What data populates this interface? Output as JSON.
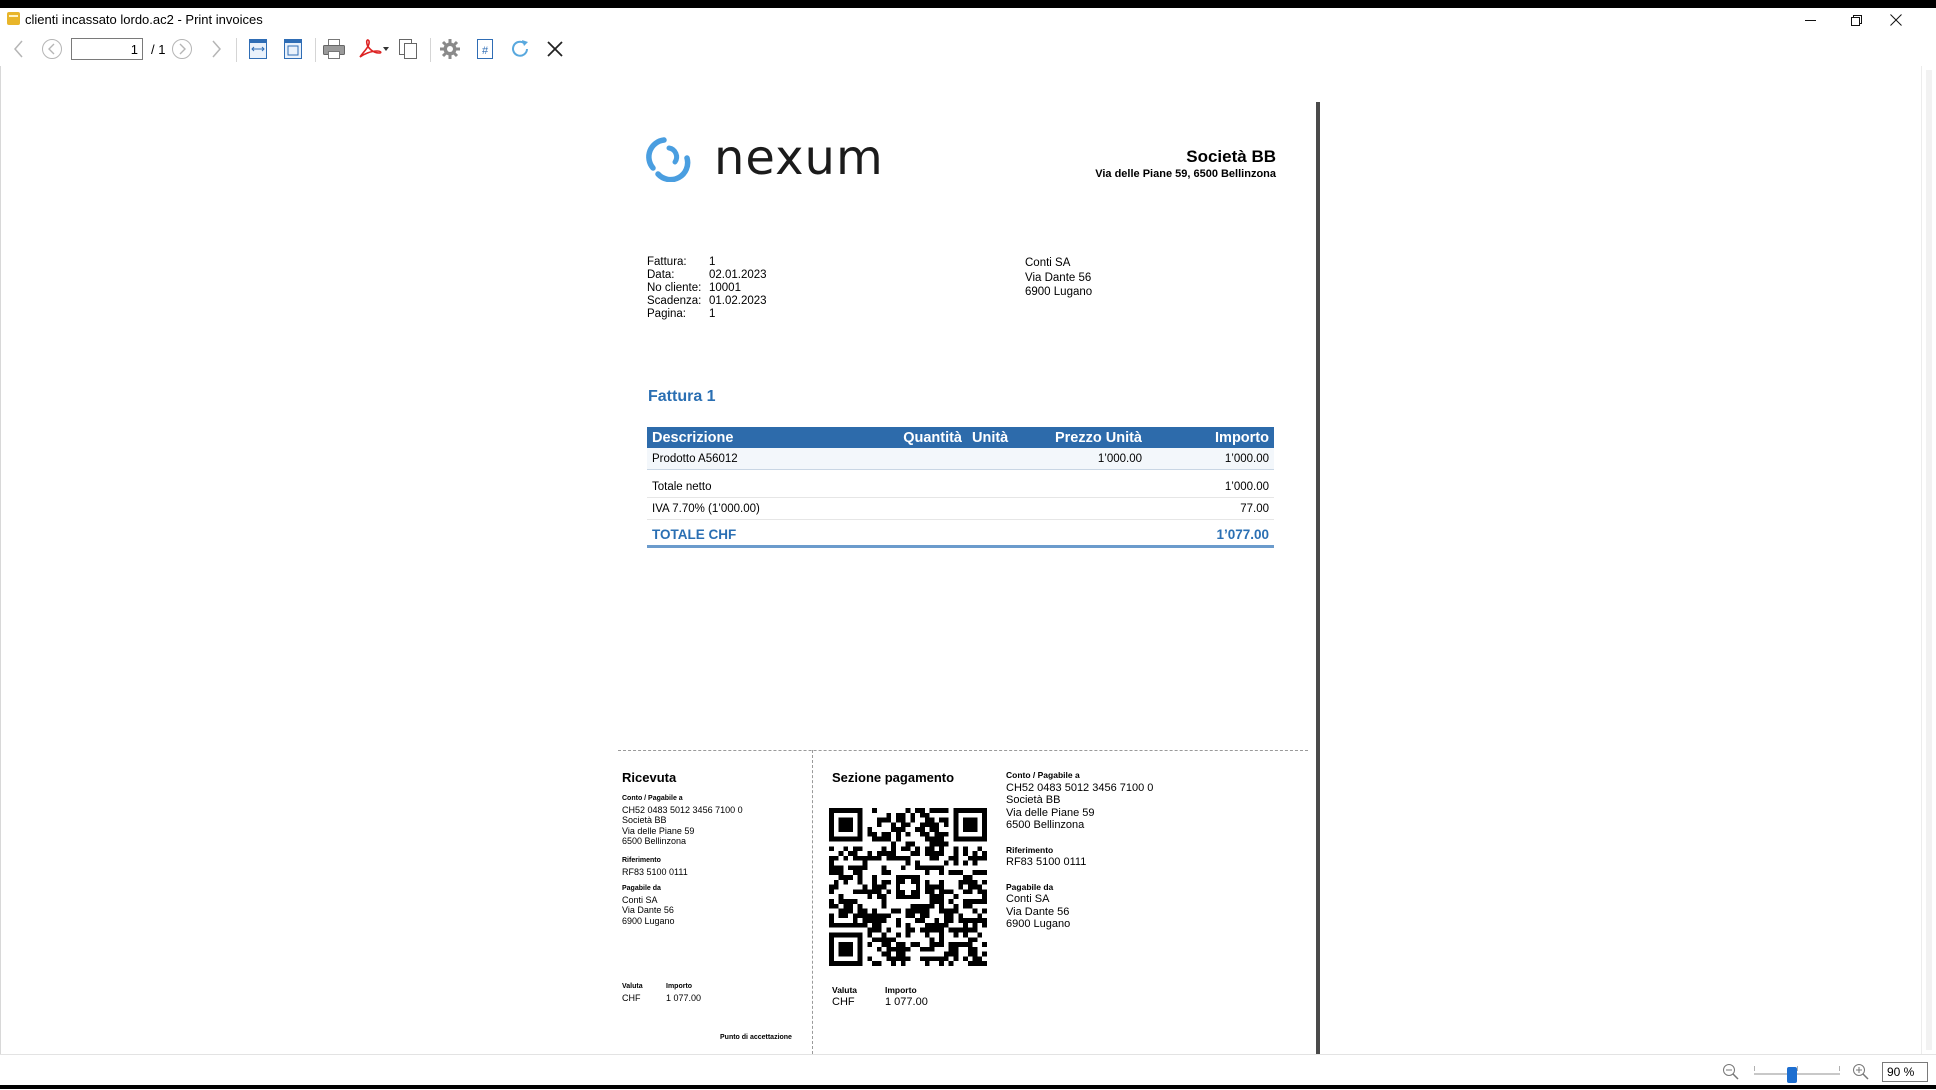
{
  "window": {
    "title": "clienti incassato lordo.ac2 - Print invoices",
    "controls": [
      "minimize",
      "restore",
      "close"
    ]
  },
  "toolbar": {
    "page_value": "1",
    "page_total": "/ 1",
    "icons": [
      "back-icon",
      "prev-page-icon",
      "next-page-icon",
      "forward-icon",
      "fit-width-icon",
      "fit-page-icon",
      "print-icon",
      "pdf-export-icon",
      "copy-pages-icon",
      "settings-icon",
      "page-number-icon",
      "refresh-icon",
      "close-icon"
    ]
  },
  "invoice": {
    "logo_text": "nexum",
    "company_name": "Società BB",
    "company_address": "Via delle Piane 59, 6500 Bellinzona",
    "meta": [
      {
        "label": "Fattura:",
        "value": "1"
      },
      {
        "label": "Data:",
        "value": "02.01.2023"
      },
      {
        "label": "No cliente:",
        "value": "10001"
      },
      {
        "label": "Scadenza:",
        "value": "01.02.2023"
      },
      {
        "label": "Pagina:",
        "value": "1"
      }
    ],
    "recipient": [
      "Conti SA",
      "Via Dante 56",
      "6900 Lugano"
    ],
    "title": "Fattura 1",
    "table": {
      "headers": [
        "Descrizione",
        "Quantità",
        "Unità",
        "Prezzo Unità",
        "Importo"
      ],
      "rows": [
        {
          "description": "Prodotto A56012",
          "quantity": "",
          "unit": "",
          "price": "1’000.00",
          "amount": "1’000.00"
        }
      ],
      "net_label": "Totale netto",
      "net_value": "1’000.00",
      "vat_label": "IVA 7.70% (1’000.00)",
      "vat_value": "77.00",
      "total_label": "TOTALE CHF",
      "total_value": "1’077.00"
    },
    "accent_color": "#2d6bab"
  },
  "payment_slip": {
    "receipt_title": "Ricevuta",
    "section_title": "Sezione pagamento",
    "account_heading": "Conto / Pagabile a",
    "account_lines": [
      "CH52 0483 5012 3456 7100 0",
      "Società BB",
      "Via delle Piane 59",
      "6500 Bellinzona"
    ],
    "reference_heading": "Riferimento",
    "reference": "RF83 5100 0111",
    "payer_heading": "Pagabile da",
    "payer_lines": [
      "Conti SA",
      "Via Dante 56",
      "6900 Lugano"
    ],
    "currency_heading": "Valuta",
    "currency": "CHF",
    "amount_heading": "Importo",
    "amount": "1 077.00",
    "acceptance_point": "Punto di accettazione"
  },
  "statusbar": {
    "zoom_value": "90 %",
    "icons": [
      "zoom-out-icon",
      "zoom-in-icon"
    ]
  }
}
